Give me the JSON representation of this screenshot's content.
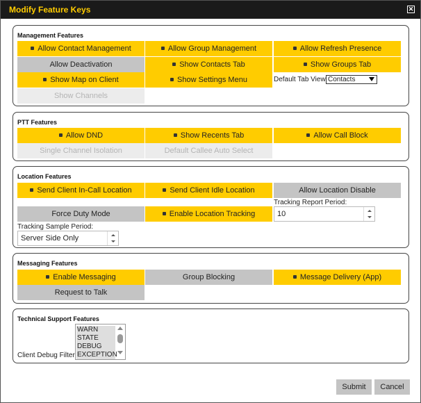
{
  "dialog": {
    "title": "Modify Feature Keys",
    "close_symbol": "✕"
  },
  "management": {
    "title": "Management Features",
    "allow_contact_management": "Allow Contact Management",
    "allow_group_management": "Allow Group Management",
    "allow_refresh_presence": "Allow Refresh Presence",
    "allow_deactivation": "Allow Deactivation",
    "show_contacts_tab": "Show Contacts Tab",
    "show_groups_tab": "Show Groups Tab",
    "show_map_on_client": "Show Map on Client",
    "show_settings_menu": "Show Settings Menu",
    "default_tab_view_label": "Default Tab View:",
    "default_tab_view_value": "Contacts",
    "show_channels": "Show Channels"
  },
  "ptt": {
    "title": "PTT Features",
    "allow_dnd": "Allow DND",
    "show_recents_tab": "Show Recents Tab",
    "allow_call_block": "Allow Call Block",
    "single_channel_isolation": "Single Channel Isolation",
    "default_callee_auto_select": "Default Callee Auto Select"
  },
  "location": {
    "title": "Location Features",
    "send_client_in_call_location": "Send Client In-Call Location",
    "send_client_idle_location": "Send Client Idle Location",
    "allow_location_disable": "Allow Location Disable",
    "force_duty_mode": "Force Duty Mode",
    "enable_location_tracking": "Enable Location Tracking",
    "tracking_report_period_label": "Tracking Report Period:",
    "tracking_report_period_value": "10",
    "tracking_sample_period_label": "Tracking Sample Period:",
    "tracking_sample_period_value": "Server Side Only"
  },
  "messaging": {
    "title": "Messaging Features",
    "enable_messaging": "Enable Messaging",
    "group_blocking": "Group Blocking",
    "message_delivery_app": "Message Delivery (App)",
    "request_to_talk": "Request to Talk"
  },
  "tech": {
    "title": "Technical Support Features",
    "client_debug_filter_label": "Client Debug Filter:",
    "debug_options": [
      "WARN",
      "STATE",
      "DEBUG",
      "EXCEPTION"
    ]
  },
  "actions": {
    "submit": "Submit",
    "cancel": "Cancel"
  },
  "colors": {
    "enabled": "#ffcc00",
    "disabled": "#c4c4c4",
    "unavailable": "#ececec",
    "title_bar": "#1a1a1a",
    "title_text": "#ffcc00"
  }
}
